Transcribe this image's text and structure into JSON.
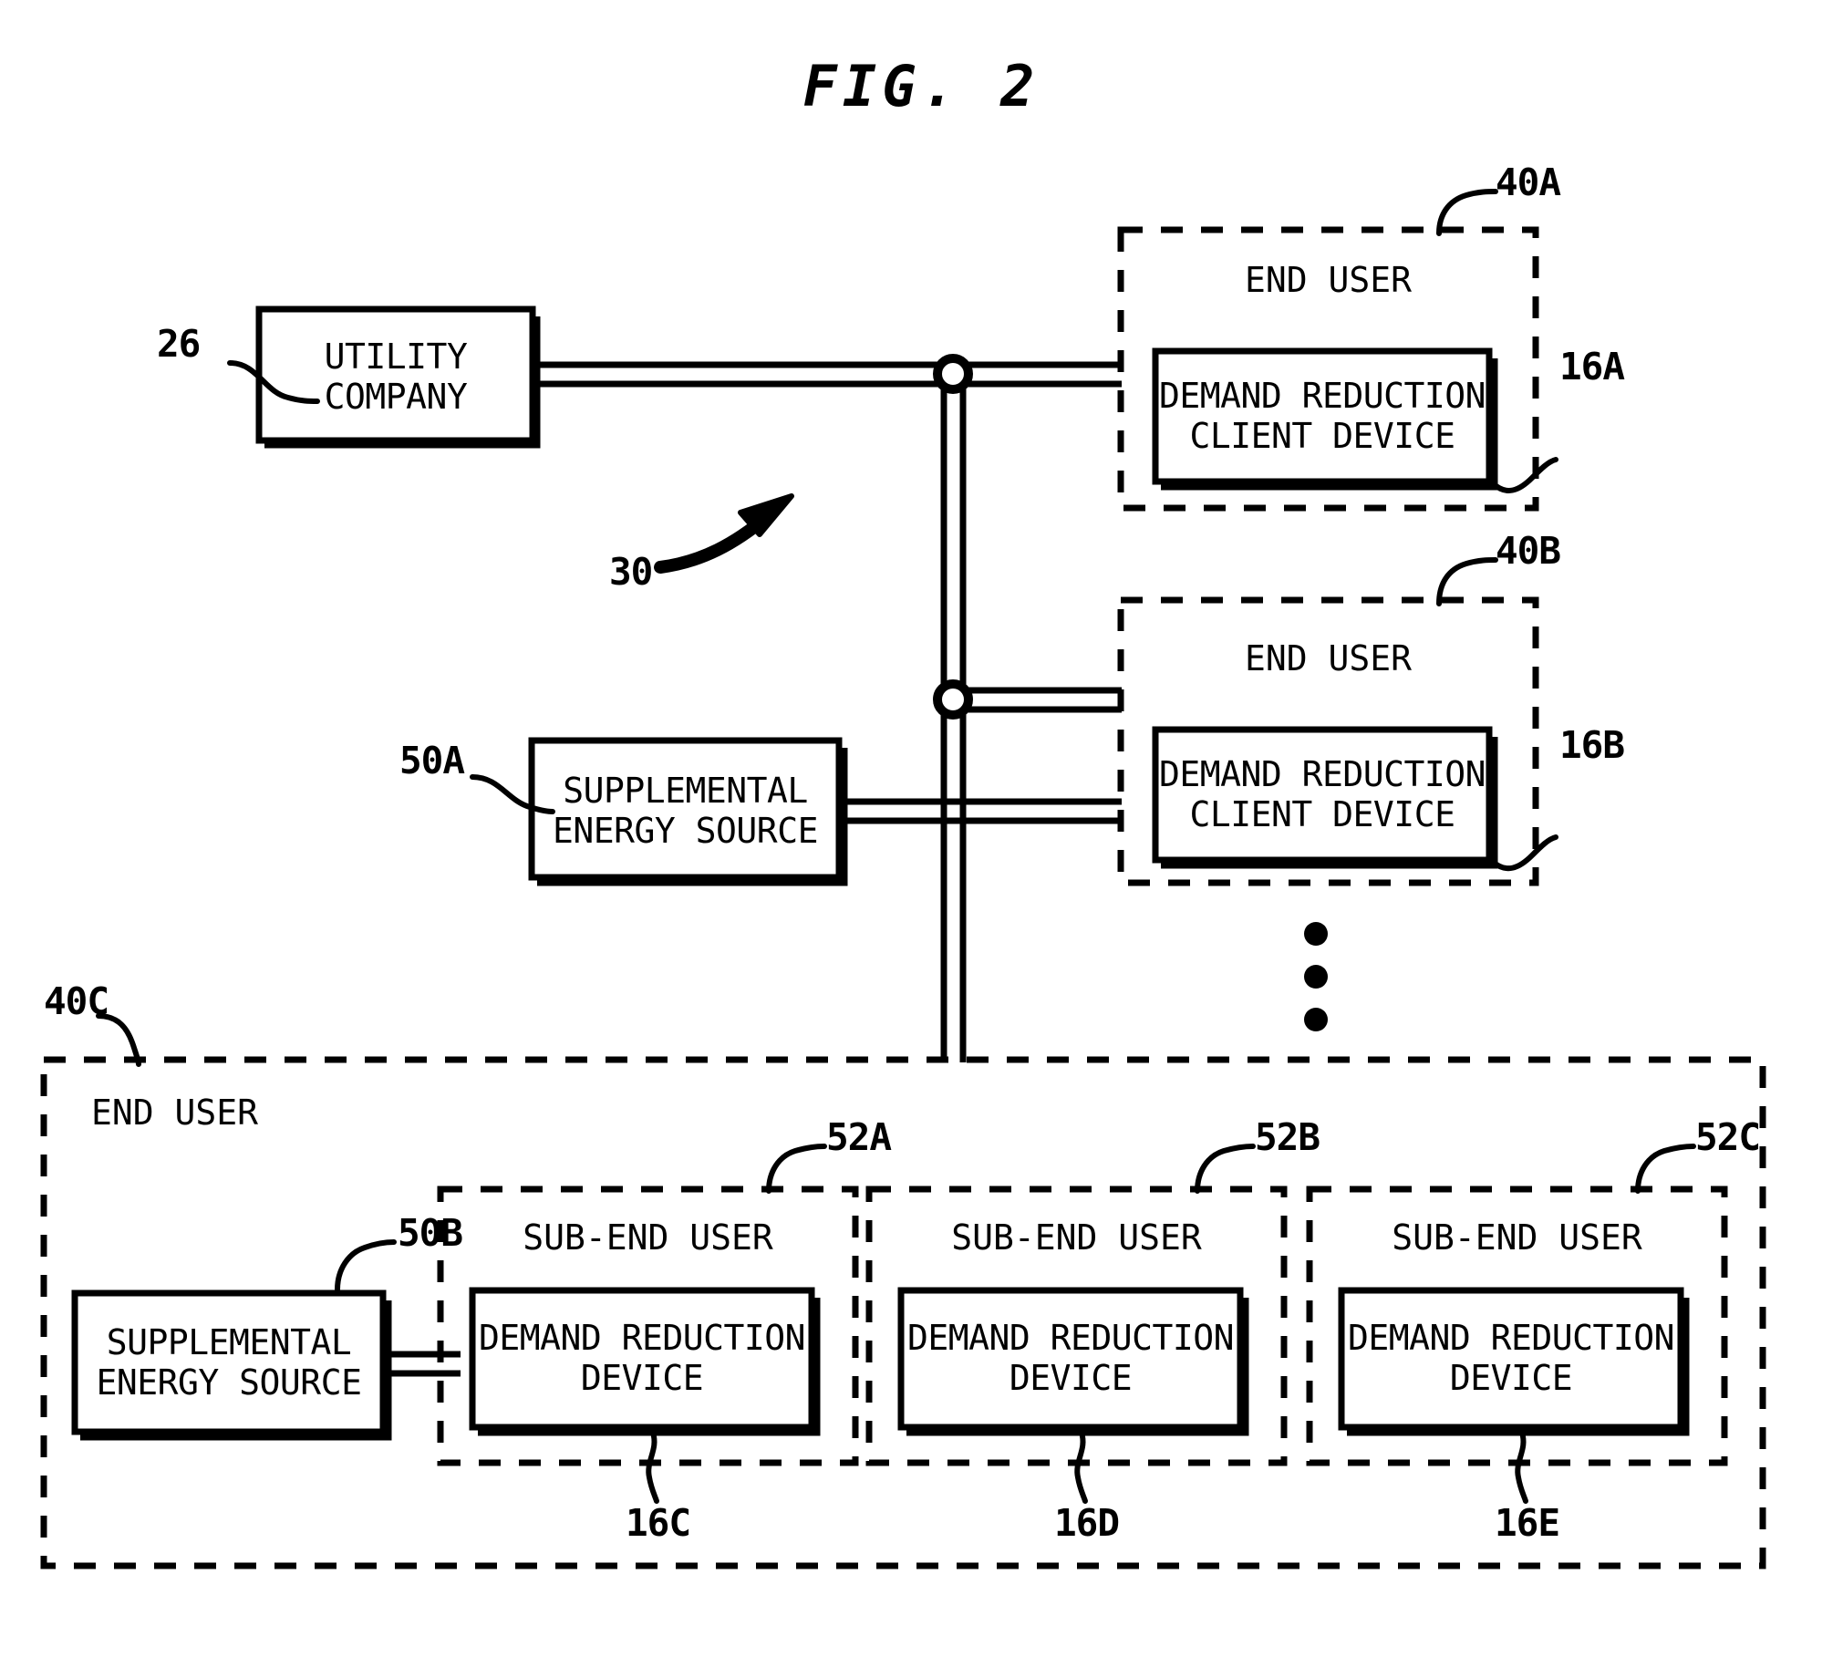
{
  "figure": {
    "title": "FIG. 2",
    "system_ref": "30"
  },
  "nodes": {
    "utility_company": {
      "label_line1": "UTILITY",
      "label_line2": "COMPANY",
      "ref": "26"
    },
    "supplemental_a": {
      "label_line1": "SUPPLEMENTAL",
      "label_line2": "ENERGY SOURCE",
      "ref": "50A"
    },
    "supplemental_b": {
      "label_line1": "SUPPLEMENTAL",
      "label_line2": "ENERGY SOURCE",
      "ref": "50B"
    }
  },
  "end_users": [
    {
      "group_label": "END USER",
      "group_ref": "40A",
      "device_line1": "DEMAND REDUCTION",
      "device_line2": "CLIENT DEVICE",
      "device_ref": "16A"
    },
    {
      "group_label": "END USER",
      "group_ref": "40B",
      "device_line1": "DEMAND REDUCTION",
      "device_line2": "CLIENT DEVICE",
      "device_ref": "16B"
    },
    {
      "group_label": "END USER",
      "group_ref": "40C"
    }
  ],
  "sub_end_users": [
    {
      "group_label": "SUB-END USER",
      "group_ref": "52A",
      "device_line1": "DEMAND REDUCTION",
      "device_line2": "DEVICE",
      "device_ref": "16C"
    },
    {
      "group_label": "SUB-END USER",
      "group_ref": "52B",
      "device_line1": "DEMAND REDUCTION",
      "device_line2": "DEVICE",
      "device_ref": "16D"
    },
    {
      "group_label": "SUB-END USER",
      "group_ref": "52C",
      "device_line1": "DEMAND REDUCTION",
      "device_line2": "DEVICE",
      "device_ref": "16E"
    }
  ],
  "style": {
    "ink": "#000000",
    "paper": "#ffffff"
  }
}
